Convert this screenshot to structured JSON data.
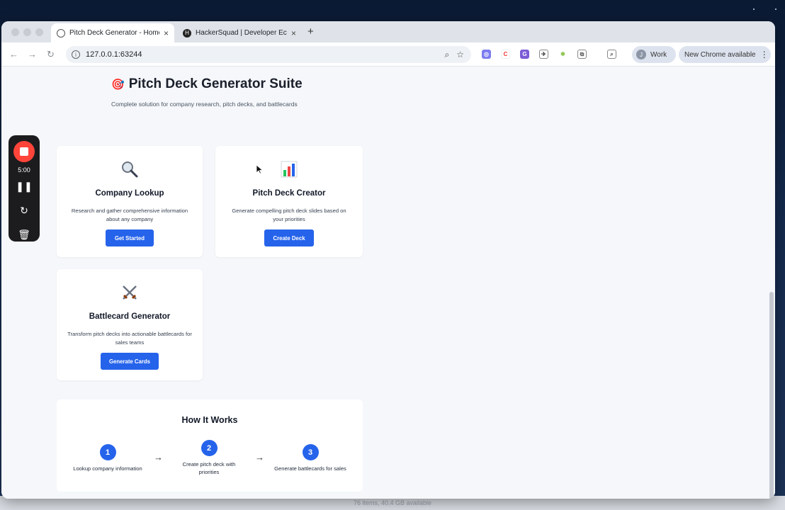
{
  "browser": {
    "tabs": [
      {
        "title": "Pitch Deck Generator - Home",
        "active": true
      },
      {
        "title": "HackerSquad | Developer Eco",
        "active": false
      }
    ],
    "url": "127.0.0.1:63244",
    "profile_label": "Work",
    "profile_initial": "J",
    "update_label": "New Chrome available"
  },
  "recorder": {
    "time": "5:00"
  },
  "page": {
    "title": "Pitch Deck Generator Suite",
    "subtitle": "Complete solution for company research, pitch decks, and battlecards",
    "cards": [
      {
        "title": "Company Lookup",
        "description": "Research and gather comprehensive information about any company",
        "button": "Get Started",
        "icon": "magnifier-icon"
      },
      {
        "title": "Pitch Deck Creator",
        "description": "Generate compelling pitch deck slides based on your priorities",
        "button": "Create Deck",
        "icon": "bar-chart-icon"
      },
      {
        "title": "Battlecard Generator",
        "description": "Transform pitch decks into actionable battlecards for sales teams",
        "button": "Generate Cards",
        "icon": "crossed-swords-icon"
      }
    ],
    "how_it_works": {
      "title": "How It Works",
      "steps": [
        {
          "num": "1",
          "label": "Lookup company information"
        },
        {
          "num": "2",
          "label": "Create pitch deck with priorities"
        },
        {
          "num": "3",
          "label": "Generate battlecards for sales"
        }
      ]
    }
  },
  "finder_status": "76 items, 40.4 GB available",
  "colors": {
    "accent": "#2563eb",
    "record": "#ff453a"
  }
}
